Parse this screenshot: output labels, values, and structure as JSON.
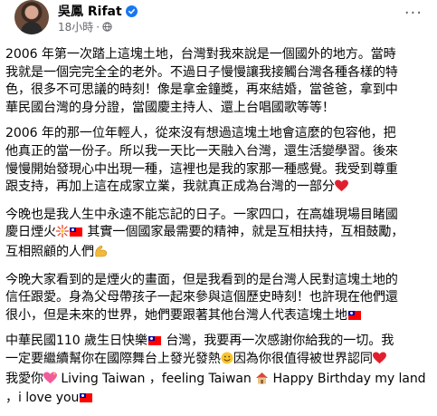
{
  "post": {
    "author": "吳鳳 Rifat",
    "time": "18小時",
    "separator": "·",
    "more": "···"
  },
  "paragraphs": [
    {
      "lines": [
        "2006 年第一次踏上這塊土地，台灣對我來說是一個國外的地方。當時",
        "我就是一個完完全全的老外。不過日子慢慢讓我接觸台灣各種各樣的特",
        "色，很多不可思議的時刻！像是拿金鐘獎，再來結婚，當爸爸，拿到中",
        "華民國台灣的身分證，當國慶主持人、還上台唱國歌等等！"
      ]
    },
    {
      "lines": [
        "2006 年的那一位年輕人，從來沒有想過這塊土地會這麼的包容他，把",
        "他真正的當一份子。所以我一天比一天融入台灣，還生活變學習。後來",
        "慢慢開始發現心中出現一種，這裡也是我的家那一種感覺。我受到尊重",
        "跟支持，再加上這在成家立業，我就真正成為台灣的一部分"
      ]
    },
    {
      "lines": [
        "今晚也是我人生中永遠不能忘記的日子。一家四口，在高雄現場目睹國",
        "慶日煙火",
        " 其實一個國家最需要的精神，就是互相扶持，互相鼓勵，",
        "互相照顧的人們"
      ]
    },
    {
      "lines": [
        "今晚大家看到的是煙火的畫面，但是我看到的是台灣人民對這塊土地的",
        "信任跟愛。身為父母帶孩子一起來參與這個歷史時刻！也許現在他們還",
        "很小，但是未來的世界，她們要跟著其他台灣人代表這塊土地"
      ]
    },
    {
      "lines": [
        "中華民國110 歲生日快樂",
        " 台灣，我要再一次感謝你給我的一切。我",
        "一定要繼續幫你在國際舞台上發光發熱",
        "因為你很值得被世界認同",
        "我愛你",
        " Living Taiwan ，feeling Taiwan ",
        " Happy Birthday my land",
        "，i love you"
      ]
    }
  ],
  "icons": {
    "verified": "verified-badge-icon",
    "privacy": "globe-icon",
    "heart": "red-heart-emoji",
    "firework": "firework-emoji",
    "flex": "flexed-biceps-emoji",
    "flag": "roc-taiwan-flag-emoji",
    "smile": "smiling-face-emoji",
    "sparkling_heart": "sparkling-heart-emoji",
    "house": "house-emoji"
  },
  "colors": {
    "verified": "#1877f2",
    "meta": "#65676b",
    "text": "#050505"
  }
}
